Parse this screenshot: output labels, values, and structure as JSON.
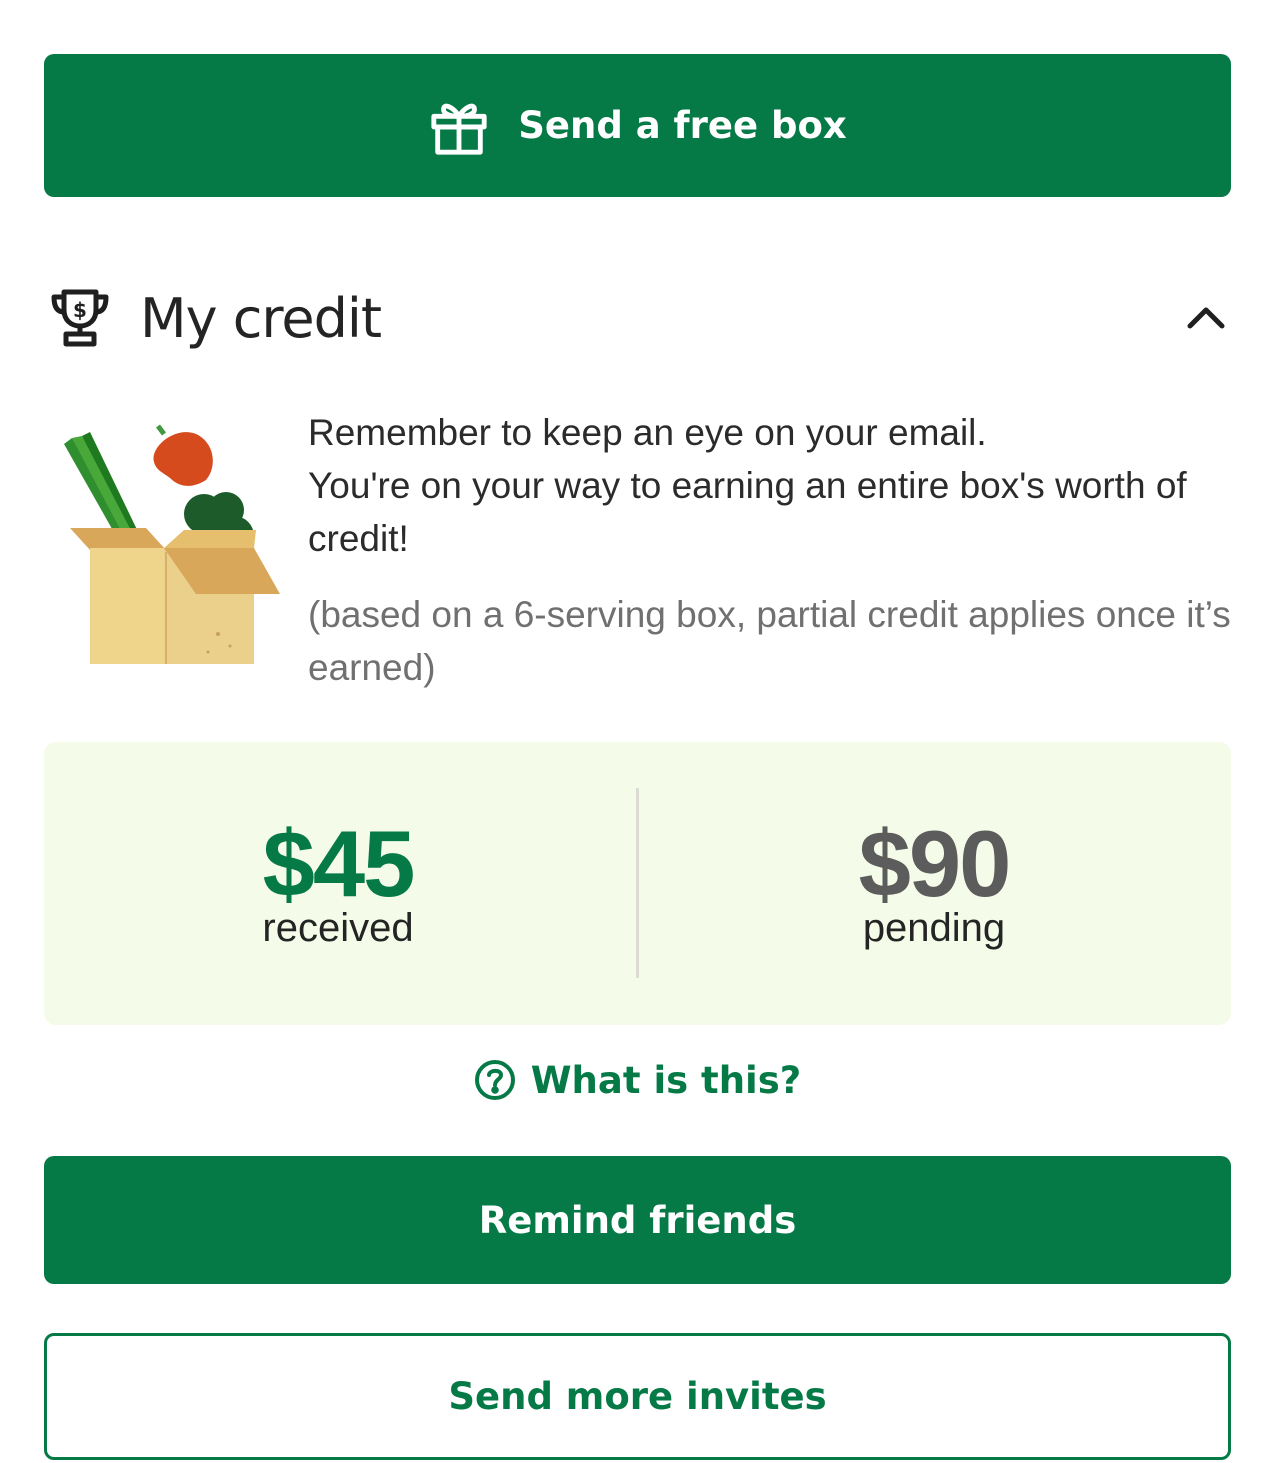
{
  "send_free_box": {
    "label": "Send a free box",
    "icon": "gift-icon"
  },
  "credit_section": {
    "title": "My credit",
    "icon": "trophy-icon",
    "toggle_icon": "chevron-up-icon",
    "message_line1": "Remember to keep an eye on your email.",
    "message_line2": "You're on your way to earning an entire box's worth of credit!",
    "note": "(based on a 6-serving box, partial credit applies once it’s earned)",
    "received_amount": "$45",
    "received_label": "received",
    "pending_amount": "$90",
    "pending_label": "pending",
    "help_label": "What is this?",
    "help_icon": "question-circle-icon"
  },
  "actions": {
    "remind_label": "Remind friends",
    "invite_label": "Send more invites"
  },
  "colors": {
    "brand_green": "#067a46",
    "panel_bg": "#f4fbe9",
    "pending_gray": "#5c5c5c"
  }
}
